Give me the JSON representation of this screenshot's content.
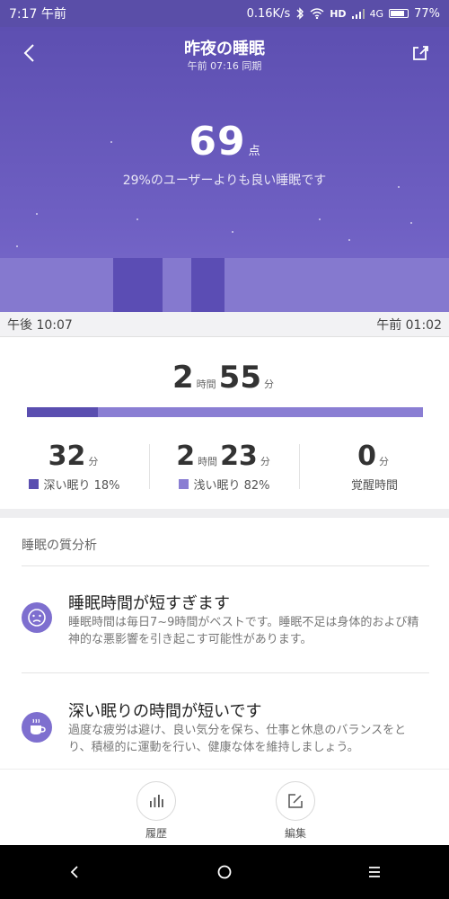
{
  "status_bar": {
    "time": "7:17 午前",
    "speed": "0.16K/s",
    "hd": "HD",
    "network": "4G",
    "battery": "77%"
  },
  "header": {
    "title": "昨夜の睡眠",
    "sync": "午前 07:16 同期",
    "score": "69",
    "score_unit": "点",
    "description": "29%のユーザーよりも良い睡眠です"
  },
  "timeline": {
    "start": "午後 10:07",
    "end": "午前 01:02",
    "deep_fraction": 0.18
  },
  "duration": {
    "hours": "2",
    "hours_unit": "時間",
    "minutes": "55",
    "minutes_unit": "分"
  },
  "stats": {
    "deep": {
      "value": "32",
      "unit": "分",
      "label": "深い眠り 18%",
      "color": "#5a4eb0"
    },
    "light": {
      "hours": "2",
      "hours_unit": "時間",
      "minutes": "23",
      "minutes_unit": "分",
      "label": "浅い眠り 82%",
      "color": "#8a7ed3"
    },
    "awake": {
      "value": "0",
      "unit": "分",
      "label": "覚醒時間"
    }
  },
  "analysis": {
    "title": "睡眠の質分析",
    "items": [
      {
        "icon": "sad-face-icon",
        "title": "睡眠時間が短すぎます",
        "desc": "睡眠時間は毎日7~9時間がベストです。睡眠不足は身体的および精神的な悪影響を引き起こす可能性があります。"
      },
      {
        "icon": "coffee-cup-icon",
        "title": "深い眠りの時間が短いです",
        "desc": "過度な疲労は避け、良い気分を保ち、仕事と休息のバランスをとり、積極的に運動を行い、健康な体を維持しましょう。"
      }
    ]
  },
  "toolbar": {
    "history": "履歴",
    "edit": "編集"
  },
  "colors": {
    "accent": "#6f60c3",
    "deep": "#5a4eb0",
    "light": "#8a7ed3"
  }
}
